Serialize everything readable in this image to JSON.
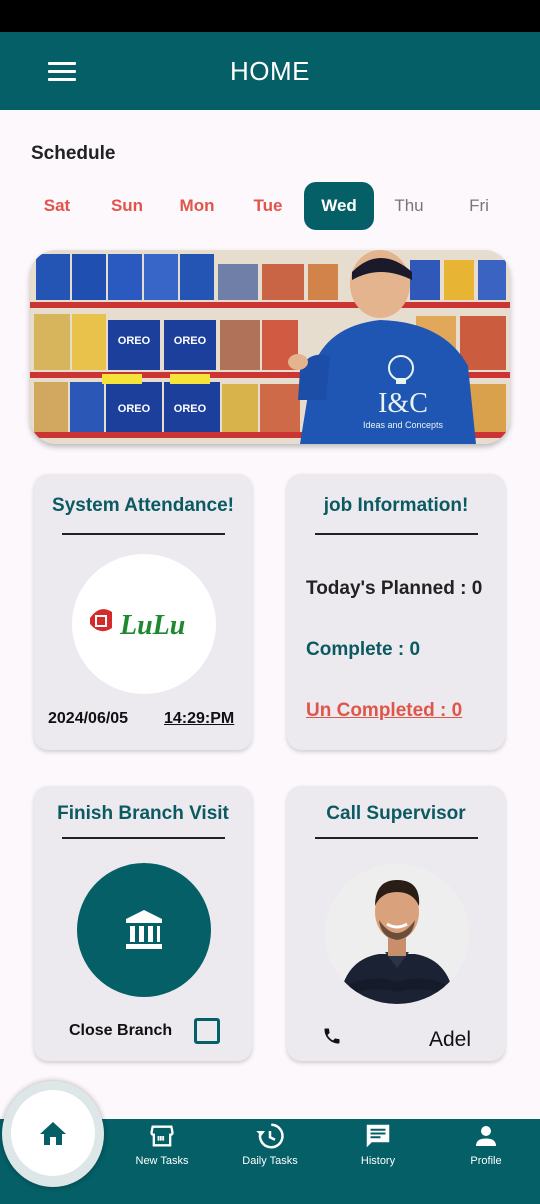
{
  "app_bar": {
    "title": "HOME",
    "menu_icon": "hamburger-menu-icon"
  },
  "schedule": {
    "title": "Schedule",
    "days": [
      "Sat",
      "Sun",
      "Mon",
      "Tue",
      "Wed",
      "Thu",
      "Fri"
    ],
    "selected": "Wed"
  },
  "banner": {
    "logo_text": "I&C",
    "logo_subtitle": "Ideas and Concepts"
  },
  "attendance": {
    "title": "System Attendance!",
    "logo_text": "LuLu",
    "date": "2024/06/05",
    "time": "14:29:PM"
  },
  "job": {
    "title": "job Information!",
    "planned": "Today's Planned : 0",
    "complete": "Complete : 0",
    "uncompleted": "Un Completed : 0"
  },
  "branch": {
    "title": "Finish Branch Visit",
    "icon": "bank-icon",
    "close_label": "Close Branch",
    "checked": false
  },
  "supervisor": {
    "title": "Call Supervisor",
    "name": "Adel",
    "icon": "phone-icon"
  },
  "bottom_nav": {
    "items": [
      {
        "label": "New Tasks",
        "icon": "store-icon"
      },
      {
        "label": "Daily Tasks",
        "icon": "history-clock-icon"
      },
      {
        "label": "History",
        "icon": "message-icon"
      },
      {
        "label": "Profile",
        "icon": "person-icon"
      }
    ],
    "home_icon": "home-icon"
  },
  "colors": {
    "primary": "#045f66",
    "accent_red": "#e0554a",
    "card_bg": "#eceaef",
    "page_bg": "#fcf8fc"
  }
}
